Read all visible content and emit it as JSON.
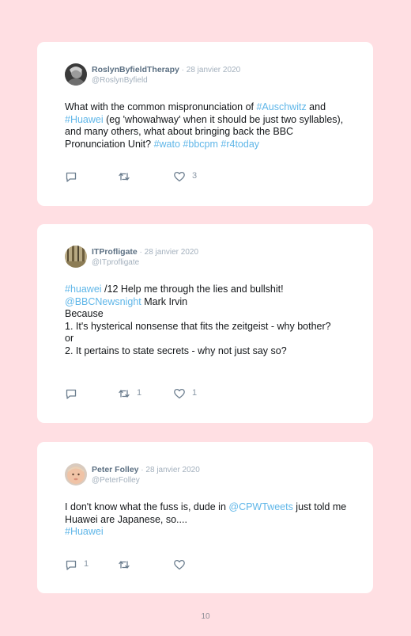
{
  "tweets": [
    {
      "name": "RoslynByfieldTherapy",
      "date": " · 28 janvier 2020",
      "handle": "@RoslynByfield",
      "text": {
        "p1": "What with the common mispronunciation of ",
        "l1": "#Auschwitz",
        "p2": " and ",
        "l2": "#Huawei",
        "p3": " (eg 'whowahway' when it should be just two syllables), and many others, what about bringing back the BBC Pronunciation Unit? ",
        "l3": "#wato",
        "l4": "#bbcpm",
        "l5": "#r4today"
      },
      "replies": "",
      "retweets": "",
      "likes": "3"
    },
    {
      "name": "ITProfligate",
      "date": " · 28 janvier 2020",
      "handle": "@ITprofligate",
      "text": {
        "l1": "#huawei",
        "p1": " /12 Help me through the lies and bullshit!",
        "l2": "@BBCNewsnight",
        "p2": " Mark Irvin",
        "line3": "Because",
        "line4": "1. It's hysterical nonsense that fits the zeitgeist - why bother?",
        "line5": "or",
        "line6": "2. It pertains to state secrets - why not just say so?"
      },
      "replies": "",
      "retweets": "1",
      "likes": "1"
    },
    {
      "name": "Peter Folley",
      "date": " · 28 janvier 2020",
      "handle": "@PeterFolley",
      "text": {
        "p1": "I don't know what the fuss is, dude in ",
        "l1": "@CPWTweets",
        "p2": " just told me Huawei are Japanese, so....",
        "l2": "#Huawei"
      },
      "replies": "1",
      "retweets": "",
      "likes": ""
    }
  ],
  "page_number": "10",
  "icons": {
    "reply": "reply-icon",
    "retweet": "retweet-icon",
    "like": "heart-icon"
  },
  "colors": {
    "background": "#ffdfe3",
    "link": "#5fb6e8",
    "name": "#5b6f82",
    "muted": "#a3b0bd"
  }
}
